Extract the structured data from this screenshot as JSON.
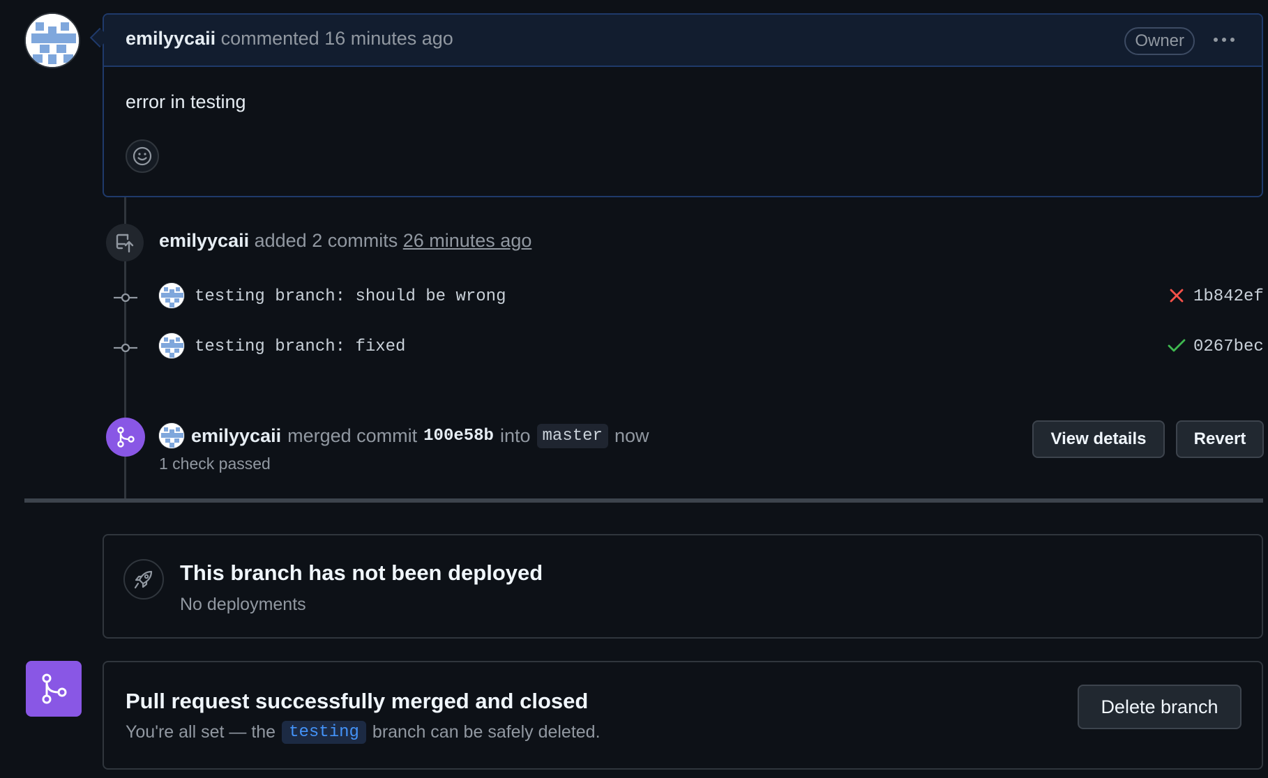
{
  "comment": {
    "author": "emilyycaii",
    "action": "commented",
    "time": "16 minutes ago",
    "badge": "Owner",
    "menu_icon": "kebab-horizontal-icon",
    "body": "error in testing",
    "reaction_icon": "smiley-icon"
  },
  "commits_event": {
    "author": "emilyycaii",
    "action": "added 2 commits",
    "time": "26 minutes ago",
    "icon": "repo-push-icon",
    "commits": [
      {
        "message": "testing branch: should be wrong",
        "status": "failure",
        "status_icon": "x-icon",
        "status_color": "#f85149",
        "sha": "1b842ef"
      },
      {
        "message": "testing branch: fixed",
        "status": "success",
        "status_icon": "check-icon",
        "status_color": "#3fb950",
        "sha": "0267bec"
      }
    ]
  },
  "merge_event": {
    "author": "emilyycaii",
    "action": "merged commit",
    "commit": "100e58b",
    "into": "into",
    "branch": "master",
    "time": "now",
    "checks": "1 check passed",
    "view_details_label": "View details",
    "revert_label": "Revert",
    "icon": "git-merge-icon"
  },
  "deployment": {
    "icon": "rocket-icon",
    "title": "This branch has not been deployed",
    "subtitle": "No deployments"
  },
  "merged_status": {
    "icon": "git-merge-icon",
    "title": "Pull request successfully merged and closed",
    "sub_before": "You're all set — the",
    "branch": "testing",
    "sub_after": "branch can be safely deleted.",
    "delete_label": "Delete branch"
  },
  "colors": {
    "background": "#0d1117",
    "merged_purple": "#8957e5",
    "link_blue": "#4493f8",
    "failure_red": "#f85149",
    "success_green": "#3fb950"
  }
}
